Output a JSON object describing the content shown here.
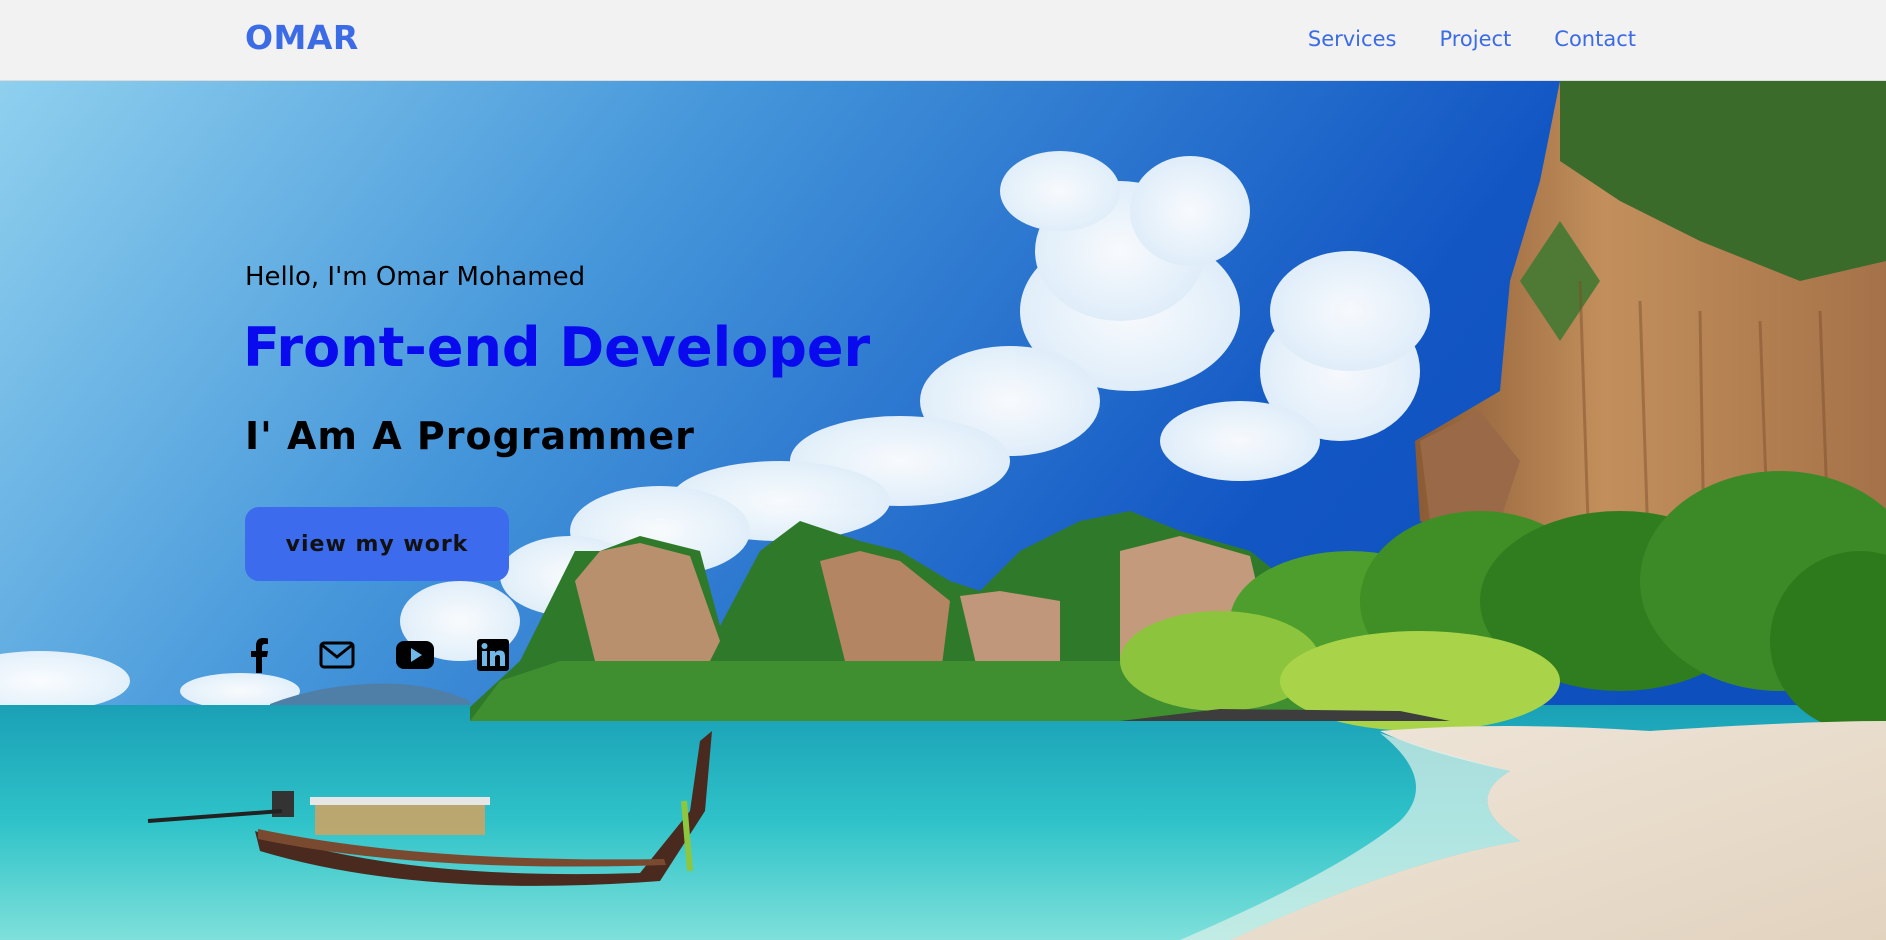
{
  "nav": {
    "logo": "OMAR",
    "links": [
      "Services",
      "Project",
      "Contact"
    ]
  },
  "hero": {
    "greeting": "Hello, I'm Omar Mohamed",
    "role": "Front-end Developer",
    "tagline": "I' Am A Programmer",
    "cta_label": "view my work"
  },
  "socials": [
    {
      "icon": "facebook-icon"
    },
    {
      "icon": "envelope-icon"
    },
    {
      "icon": "youtube-icon"
    },
    {
      "icon": "linkedin-icon"
    }
  ],
  "colors": {
    "accent": "#3c6be6",
    "role_text": "#0a0aee",
    "button_bg": "#3c6bed",
    "navbar_bg": "#f2f2f2"
  }
}
